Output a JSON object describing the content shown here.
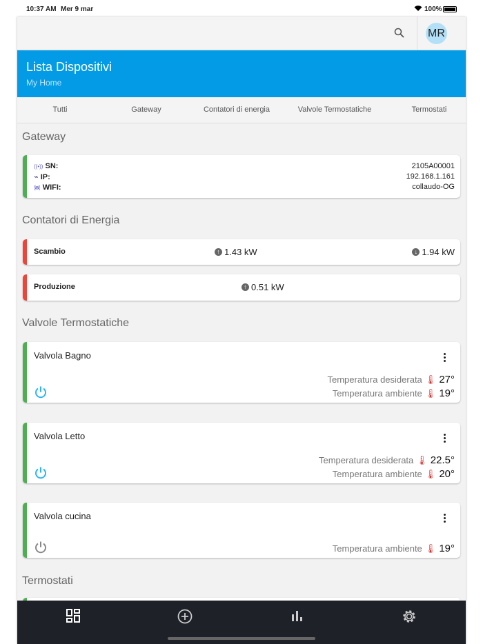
{
  "status": {
    "time": "10:37 AM",
    "date": "Mer 9 mar",
    "battery": "100%"
  },
  "toolbar": {
    "avatar": "MR"
  },
  "header": {
    "title": "Lista Dispositivi",
    "subtitle": "My Home"
  },
  "tabs": [
    "Tutti",
    "Gateway",
    "Contatori di energia",
    "Valvole Termostatiche",
    "Termostati"
  ],
  "gateway": {
    "heading": "Gateway",
    "rows": [
      {
        "label": "SN:",
        "value": "2105A00001"
      },
      {
        "label": "IP:",
        "value": "192.168.1.161"
      },
      {
        "label": "WIFI:",
        "value": "collaudo-OG"
      }
    ]
  },
  "energy": {
    "heading": "Contatori di Energia",
    "meters": [
      {
        "name": "Scambio",
        "up": "1.43 kW",
        "down": "1.94 kW"
      },
      {
        "name": "Produzione",
        "up": "0.51 kW"
      }
    ]
  },
  "valves": {
    "heading": "Valvole Termostatiche",
    "items": [
      {
        "name": "Valvola Bagno",
        "desired_label": "Temperatura desiderata",
        "desired": "27°",
        "ambient_label": "Temperatura ambiente",
        "ambient": "19°",
        "on": true
      },
      {
        "name": "Valvola Letto",
        "desired_label": "Temperatura desiderata",
        "desired": "22.5°",
        "ambient_label": "Temperatura ambiente",
        "ambient": "20°",
        "on": true
      },
      {
        "name": "Valvola cucina",
        "ambient_label": "Temperatura ambiente",
        "ambient": "19°",
        "on": false
      }
    ]
  },
  "thermostats": {
    "heading": "Termostati"
  },
  "colors": {
    "accent": "#039be5",
    "ok": "#4caf50",
    "alert": "#f44336",
    "nav": "#1f2129"
  }
}
